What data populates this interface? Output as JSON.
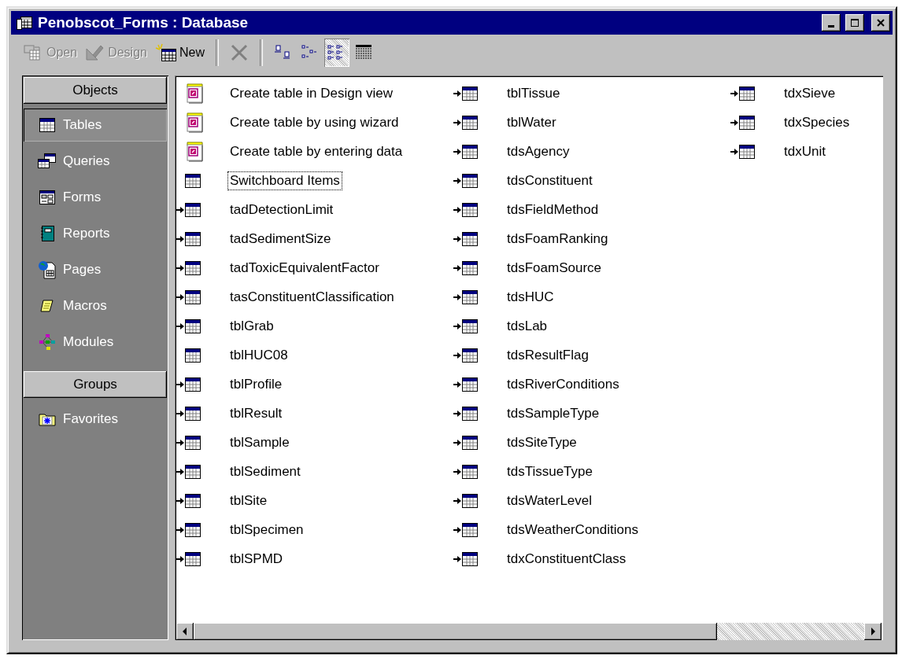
{
  "window": {
    "title": "Penobscot_Forms : Database"
  },
  "actions": [
    {
      "kind": "open",
      "label": "Open",
      "disabled": true
    },
    {
      "kind": "design",
      "label": "Design",
      "disabled": true
    },
    {
      "kind": "new",
      "label": "New",
      "disabled": false
    },
    {
      "kind": "delete",
      "disabled": true
    }
  ],
  "views": [
    {
      "kind": "large-icons",
      "selected": false
    },
    {
      "kind": "small-icons",
      "selected": false
    },
    {
      "kind": "list",
      "selected": true
    },
    {
      "kind": "details",
      "selected": false
    }
  ],
  "sidebar": {
    "objects_header": "Objects",
    "objects": [
      {
        "kind": "tables",
        "label": "Tables",
        "selected": true
      },
      {
        "kind": "queries",
        "label": "Queries",
        "selected": false
      },
      {
        "kind": "forms",
        "label": "Forms",
        "selected": false
      },
      {
        "kind": "reports",
        "label": "Reports",
        "selected": false
      },
      {
        "kind": "pages",
        "label": "Pages",
        "selected": false
      },
      {
        "kind": "macros",
        "label": "Macros",
        "selected": false
      },
      {
        "kind": "modules",
        "label": "Modules",
        "selected": false
      }
    ],
    "groups_header": "Groups",
    "groups": [
      {
        "kind": "favorites",
        "label": "Favorites",
        "selected": false
      }
    ]
  },
  "items": [
    {
      "kind": "wizard",
      "label": "Create table in Design view",
      "linked": false,
      "focused": false
    },
    {
      "kind": "wizard",
      "label": "Create table by using wizard",
      "linked": false,
      "focused": false
    },
    {
      "kind": "wizard",
      "label": "Create table by entering data",
      "linked": false,
      "focused": false
    },
    {
      "kind": "table",
      "label": "Switchboard Items",
      "linked": false,
      "focused": true
    },
    {
      "kind": "table",
      "label": "tadDetectionLimit",
      "linked": true,
      "focused": false
    },
    {
      "kind": "table",
      "label": "tadSedimentSize",
      "linked": true,
      "focused": false
    },
    {
      "kind": "table",
      "label": "tadToxicEquivalentFactor",
      "linked": true,
      "focused": false
    },
    {
      "kind": "table",
      "label": "tasConstituentClassification",
      "linked": true,
      "focused": false
    },
    {
      "kind": "table",
      "label": "tblGrab",
      "linked": true,
      "focused": false
    },
    {
      "kind": "table",
      "label": "tblHUC08",
      "linked": false,
      "focused": false
    },
    {
      "kind": "table",
      "label": "tblProfile",
      "linked": true,
      "focused": false
    },
    {
      "kind": "table",
      "label": "tblResult",
      "linked": true,
      "focused": false
    },
    {
      "kind": "table",
      "label": "tblSample",
      "linked": true,
      "focused": false
    },
    {
      "kind": "table",
      "label": "tblSediment",
      "linked": true,
      "focused": false
    },
    {
      "kind": "table",
      "label": "tblSite",
      "linked": true,
      "focused": false
    },
    {
      "kind": "table",
      "label": "tblSpecimen",
      "linked": true,
      "focused": false
    },
    {
      "kind": "table",
      "label": "tblSPMD",
      "linked": true,
      "focused": false
    },
    {
      "kind": "table",
      "label": "tblTissue",
      "linked": true,
      "focused": false
    },
    {
      "kind": "table",
      "label": "tblWater",
      "linked": true,
      "focused": false
    },
    {
      "kind": "table",
      "label": "tdsAgency",
      "linked": true,
      "focused": false
    },
    {
      "kind": "table",
      "label": "tdsConstituent",
      "linked": true,
      "focused": false
    },
    {
      "kind": "table",
      "label": "tdsFieldMethod",
      "linked": true,
      "focused": false
    },
    {
      "kind": "table",
      "label": "tdsFoamRanking",
      "linked": true,
      "focused": false
    },
    {
      "kind": "table",
      "label": "tdsFoamSource",
      "linked": true,
      "focused": false
    },
    {
      "kind": "table",
      "label": "tdsHUC",
      "linked": true,
      "focused": false
    },
    {
      "kind": "table",
      "label": "tdsLab",
      "linked": true,
      "focused": false
    },
    {
      "kind": "table",
      "label": "tdsResultFlag",
      "linked": true,
      "focused": false
    },
    {
      "kind": "table",
      "label": "tdsRiverConditions",
      "linked": true,
      "focused": false
    },
    {
      "kind": "table",
      "label": "tdsSampleType",
      "linked": true,
      "focused": false
    },
    {
      "kind": "table",
      "label": "tdsSiteType",
      "linked": true,
      "focused": false
    },
    {
      "kind": "table",
      "label": "tdsTissueType",
      "linked": true,
      "focused": false
    },
    {
      "kind": "table",
      "label": "tdsWaterLevel",
      "linked": true,
      "focused": false
    },
    {
      "kind": "table",
      "label": "tdsWeatherConditions",
      "linked": true,
      "focused": false
    },
    {
      "kind": "table",
      "label": "tdxConstituentClass",
      "linked": true,
      "focused": false
    },
    {
      "kind": "table",
      "label": "tdxSieve",
      "linked": true,
      "focused": false
    },
    {
      "kind": "table",
      "label": "tdxSpecies",
      "linked": true,
      "focused": false
    },
    {
      "kind": "table",
      "label": "tdxUnit",
      "linked": true,
      "focused": false
    }
  ]
}
